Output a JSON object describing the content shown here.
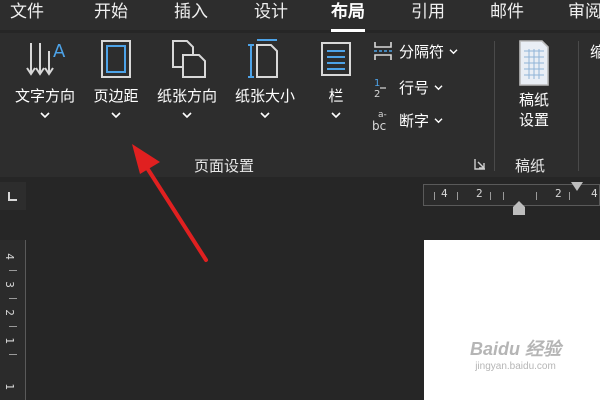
{
  "tabs": [
    "文件",
    "开始",
    "插入",
    "设计",
    "布局",
    "引用",
    "邮件",
    "审阅"
  ],
  "active_tab": "布局",
  "ribbon": {
    "text_direction_label": "文字方向",
    "margins_label": "页边距",
    "orientation_label": "纸张方向",
    "size_label": "纸张大小",
    "columns_label": "栏",
    "breaks_label": "分隔符",
    "line_numbers_label": "行号",
    "hyphenation_label": "断字",
    "manuscript_label": "稿纸\n设置",
    "manuscript_line1": "稿纸",
    "manuscript_line2": "设置",
    "page_setup_group": "页面设置",
    "manuscript_group": "稿纸",
    "cut_off_next": "缩"
  },
  "rulers": {
    "horizontal_numbers": [
      "4",
      "2",
      "",
      "2",
      "4"
    ],
    "vertical_numbers": [
      "4",
      "3",
      "2",
      "1",
      "1"
    ]
  },
  "watermark": {
    "line1": "Baidu 经验",
    "line2": "jingyan.baidu.com"
  },
  "colors": {
    "background": "#262626",
    "ribbon": "#2d2d2d",
    "icon_blue": "#4da3e8",
    "arrow_red": "#e02020"
  }
}
